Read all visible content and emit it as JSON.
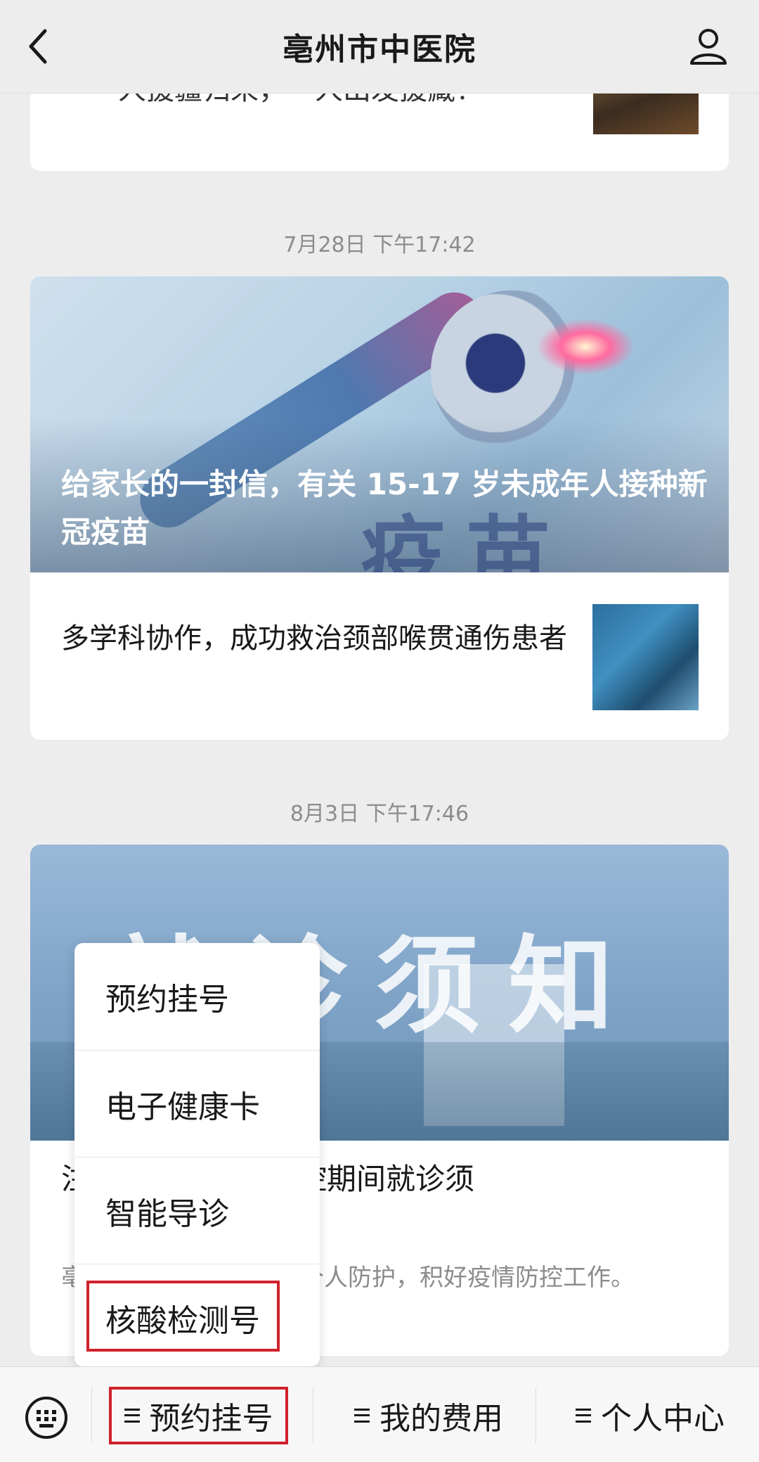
{
  "header": {
    "title": "亳州市中医院"
  },
  "feed": {
    "card1": {
      "snippet": "一人援疆归来，一人出发援藏！"
    },
    "stamp1": "7月28日 下午17:42",
    "card2": {
      "hero_title": "给家长的一封信，有关 15-17 岁未成年人接种新冠疫苗",
      "hero_overlay": "疫苗",
      "item_title": "多学科协作，成功救治颈部喉贯通伤患者"
    },
    "stamp2": "8月3日 下午17:46",
    "card3": {
      "hero_overlay": "就诊须知",
      "title_visible": "注院常态化疫情防控期间就诊须",
      "desc_visible": "亳求：来院就诊时加强个人防护，积好疫情防控工作。"
    }
  },
  "popup_menu": {
    "items": [
      "预约挂号",
      "电子健康卡",
      "智能导诊",
      "核酸检测号"
    ],
    "highlighted_index": 3
  },
  "bottom_bar": {
    "tabs": [
      "预约挂号",
      "我的费用",
      "个人中心"
    ],
    "highlighted_tab": 0
  },
  "colors": {
    "highlight_border": "#d0222d",
    "background": "#ededed"
  },
  "icons": [
    "back-arrow-icon",
    "user-icon",
    "keyboard-icon",
    "menu-lines-icon"
  ]
}
